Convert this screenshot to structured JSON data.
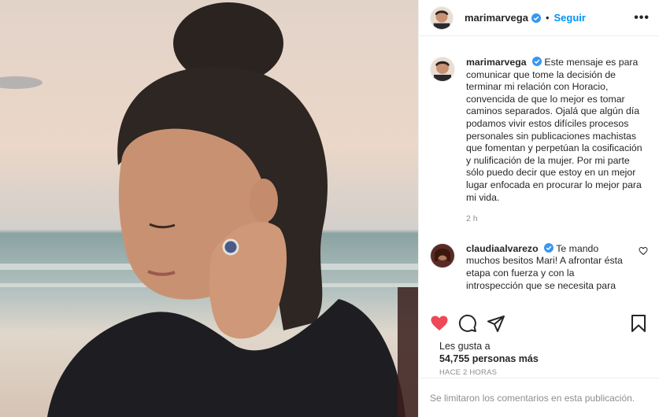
{
  "header": {
    "username": "marimarvega",
    "separator": "•",
    "follow_label": "Seguir",
    "more": "•••"
  },
  "caption": {
    "username": "marimarvega",
    "text": "Este mensaje es para comunicar que tome la decisión de terminar mi relación con Horacio, convencida de que lo mejor es tomar caminos separados. Ojalá que algún día podamos vivir estos difíciles procesos personales sin publicaciones machistas que fomentan y perpetúan la cosificación y nulificación de la mujer. Por mi parte sólo puedo decir que estoy en un mejor lugar enfocada en procurar lo mejor para mi vida.",
    "time": "2 h"
  },
  "comment": {
    "username": "claudiaalvarezo",
    "text": "Te mando muchos besitos Mari! A afrontar ésta etapa con fuerza y con la introspección que se necesita para"
  },
  "likes": {
    "label": "Les gusta a",
    "count": "54,755 personas más"
  },
  "posted_ago": "HACE 2 HORAS",
  "comments_limited": "Se limitaron los comentarios en esta publicación.",
  "colors": {
    "accent": "#0095f6",
    "liked": "#ed4956",
    "muted": "#8e8e8e"
  }
}
